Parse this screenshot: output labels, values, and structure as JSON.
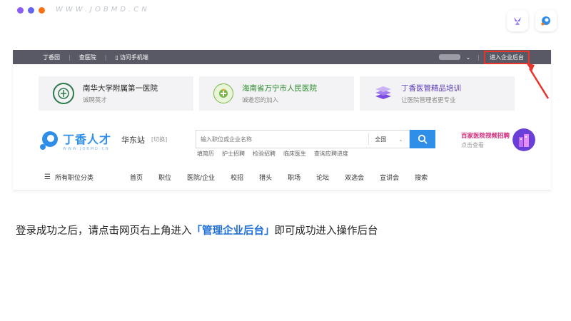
{
  "slide": {
    "url_watermark": "WWW.JOBMD.CN",
    "instruction_before": "登录成功之后，请点击网页右上角进入",
    "instruction_highlight": "「管理企业后台」",
    "instruction_after": "即可成功进入操作后台"
  },
  "colors": {
    "dot1": "#8b5cf6",
    "dot2": "#6366f1",
    "dot3": "#f97316",
    "topbar": "#595966",
    "accent": "#2f8ee8",
    "highlight_box": "#e8342a"
  },
  "topbar": {
    "links": [
      "丁香园",
      "查医院",
      "访问手机端"
    ],
    "enter_backend": "进入企业后台"
  },
  "hospitals": [
    {
      "name": "南华大学附属第一医院",
      "sub": "诚聘英才"
    },
    {
      "name": "海南省万宁市人民医院",
      "sub": "诚邀您的加入"
    },
    {
      "name": "丁香医管精品培训",
      "sub": "让医院管理者更专业"
    }
  ],
  "header": {
    "logo_cn": "丁香人才",
    "logo_en": "WWW.JOBMD.CN",
    "region": "华东站",
    "switch": "[切换]",
    "search_placeholder": "输入职位或企业名称",
    "search_scope": "全国",
    "hot_links": [
      "填简历",
      "护士招聘",
      "检验招聘",
      "临床医生",
      "查询应聘进度"
    ],
    "video_title": "百家医院视频招聘",
    "video_sub": "点击查看"
  },
  "menu": {
    "all_categories": "所有职位分类",
    "items": [
      "首页",
      "职位",
      "医院/企业",
      "校招",
      "猎头",
      "职场",
      "论坛",
      "双选会",
      "宣讲会",
      "搜索"
    ]
  }
}
